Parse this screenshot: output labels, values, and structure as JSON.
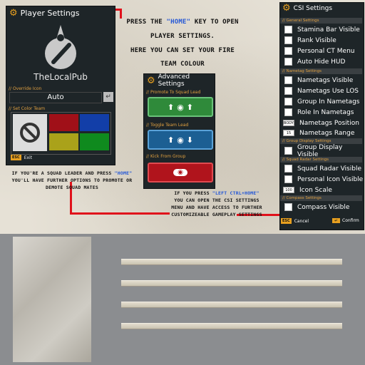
{
  "player_settings": {
    "title": "Player Settings",
    "username": "TheLocalPub",
    "override_icon_label": "// Override Icon",
    "icon_value": "Auto",
    "set_color_label": "// Set Color Team",
    "esc_key": "ESC",
    "exit_label": "Exit",
    "swatches": [
      "#a01018",
      "#123ea8",
      "#aaa21a",
      "#0f8a1e"
    ]
  },
  "advanced_settings": {
    "title": "Advanced Settings",
    "promote_label": "// Promote To Squad Lead",
    "toggle_label": "// Toggle Team Lead",
    "kick_label": "// Kick From Group"
  },
  "annotations": {
    "home_prefix": "PRESS THE ",
    "home_key": "\"HOME\"",
    "home_suffix": " KEY TO OPEN",
    "home_line2": "PLAYER SETTINGS.",
    "home_line3": "HERE YOU CAN SET YOUR FIRE",
    "home_line4": "TEAM COLOUR",
    "squad_prefix": "IF YOU'RE A SQUAD LEADER AND PRESS ",
    "squad_key": "\"HOME\"",
    "squad_rest": "YOU'LL HAVE FURTHER OPTIONS TO PROMOTE OR DEMOTE SQUAD MATES",
    "csi_prefix": "IF YOU PRESS ",
    "csi_key": "\"LEFT CTRL+HOME\"",
    "csi_rest": "YOU CAN OPEN THE CSI SETTINGS MENU AND HAVE ACCESS TO FURTHER CUSTOMIZEABLE GAMEPLAY SETTINGS"
  },
  "csi_settings": {
    "title": "CSI Settings",
    "general_header": "// General Settings",
    "general": [
      "Stamina Bar Visible",
      "Rank Visible",
      "Personal CT Menu",
      "Auto Hide HUD"
    ],
    "nametag_header": "// Nametag Settings",
    "nametag": [
      "Nametags Visible",
      "Nametags Use LOS",
      "Group In Nametags",
      "Role In Nametags"
    ],
    "position_value": "BODY",
    "position_label": "Nametags Position",
    "range_value": "15",
    "range_label": "Nametags Range",
    "group_header": "// Group Display Settings",
    "group_label": "Group Display Visible",
    "radar_header": "// Squad Radar Settings",
    "radar": [
      "Squad Radar Visible",
      "Personal Icon Visible"
    ],
    "scale_value": "100",
    "scale_label": "Icon Scale",
    "compass_header": "// Compass Settings",
    "compass_label": "Compass Visible",
    "esc_key": "ESC",
    "cancel_label": "Cancel",
    "confirm_label": "Confirm"
  }
}
